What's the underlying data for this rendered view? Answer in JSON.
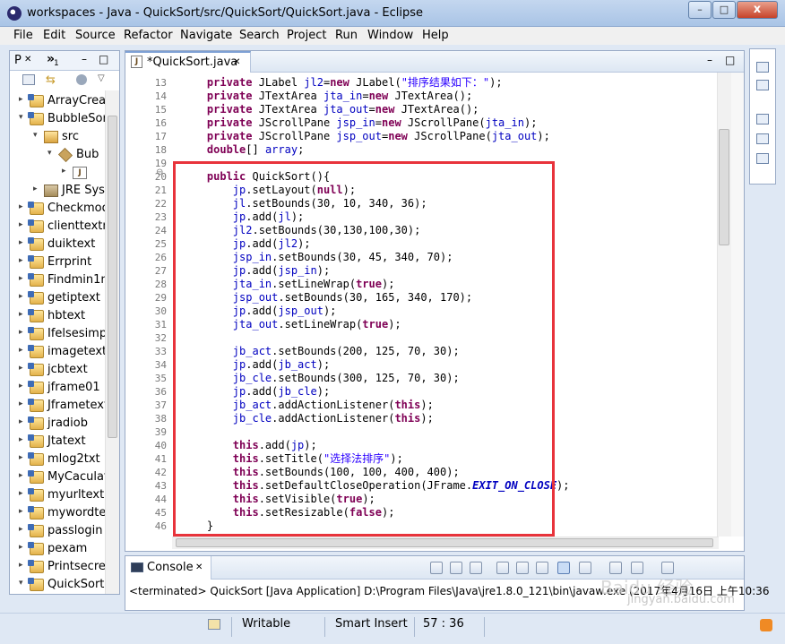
{
  "window": {
    "title": "workspaces - Java - QuickSort/src/QuickSort/QuickSort.java - Eclipse",
    "minimize": "–",
    "maximize": "□",
    "close": "x"
  },
  "menu": [
    "File",
    "Edit",
    "Source",
    "Refactor",
    "Navigate",
    "Search",
    "Project",
    "Run",
    "Window",
    "Help"
  ],
  "package_explorer": {
    "tab_label": "P",
    "tab_close": "✕",
    "second_tab": "»",
    "second_tab_count": "1",
    "minimize": "–",
    "maximize": "□",
    "tree": [
      {
        "label": "ArrayCrea",
        "indent": 1,
        "type": "project",
        "expand": "▸"
      },
      {
        "label": "BubbleSor",
        "indent": 1,
        "type": "project",
        "expand": "▾"
      },
      {
        "label": "src",
        "indent": 2,
        "type": "srcfolder",
        "expand": "▾"
      },
      {
        "label": "Bub",
        "indent": 3,
        "type": "package",
        "expand": "▾"
      },
      {
        "label": "",
        "indent": 4,
        "type": "javafile",
        "expand": "▸"
      },
      {
        "label": "JRE Sys",
        "indent": 2,
        "type": "library",
        "expand": "▸"
      },
      {
        "label": "Checkmod",
        "indent": 1,
        "type": "project",
        "expand": "▸"
      },
      {
        "label": "clienttextn",
        "indent": 1,
        "type": "project",
        "expand": "▸"
      },
      {
        "label": "duiktext",
        "indent": 1,
        "type": "project",
        "expand": "▸"
      },
      {
        "label": "Errprint",
        "indent": 1,
        "type": "project",
        "expand": "▸"
      },
      {
        "label": "Findmin1n",
        "indent": 1,
        "type": "project",
        "expand": "▸"
      },
      {
        "label": "getiptext",
        "indent": 1,
        "type": "project",
        "expand": "▸"
      },
      {
        "label": "hbtext",
        "indent": 1,
        "type": "project",
        "expand": "▸"
      },
      {
        "label": "Ifelsesimp",
        "indent": 1,
        "type": "project",
        "expand": "▸"
      },
      {
        "label": "imagetext",
        "indent": 1,
        "type": "project",
        "expand": "▸"
      },
      {
        "label": "jcbtext",
        "indent": 1,
        "type": "project",
        "expand": "▸"
      },
      {
        "label": "jframe01",
        "indent": 1,
        "type": "project",
        "expand": "▸"
      },
      {
        "label": "Jframetext",
        "indent": 1,
        "type": "project",
        "expand": "▸"
      },
      {
        "label": "jradiob",
        "indent": 1,
        "type": "project",
        "expand": "▸"
      },
      {
        "label": "Jtatext",
        "indent": 1,
        "type": "project",
        "expand": "▸"
      },
      {
        "label": "mlog2txt",
        "indent": 1,
        "type": "project",
        "expand": "▸"
      },
      {
        "label": "MyCaculat",
        "indent": 1,
        "type": "project",
        "expand": "▸"
      },
      {
        "label": "myurltext",
        "indent": 1,
        "type": "project",
        "expand": "▸"
      },
      {
        "label": "mywordte",
        "indent": 1,
        "type": "project",
        "expand": "▸"
      },
      {
        "label": "passlogin",
        "indent": 1,
        "type": "project",
        "expand": "▸"
      },
      {
        "label": "pexam",
        "indent": 1,
        "type": "project",
        "expand": "▸"
      },
      {
        "label": "Printsecre",
        "indent": 1,
        "type": "project",
        "expand": "▸"
      },
      {
        "label": "QuickSort",
        "indent": 1,
        "type": "project",
        "expand": "▾"
      }
    ]
  },
  "editor": {
    "tab_label": "*QuickSort.java",
    "tab_close": "✕",
    "minimize": "–",
    "maximize": "□",
    "fold_marker": "⊖",
    "lines": [
      {
        "n": "13",
        "t": [
          [
            "    ",
            ""
          ],
          [
            "private",
            "kw"
          ],
          [
            " JLabel ",
            ""
          ],
          [
            "jl2",
            "fld"
          ],
          [
            "=",
            ""
          ],
          [
            "new",
            "kw"
          ],
          [
            " JLabel(",
            ""
          ],
          [
            "\"排序结果如下：\"",
            "str"
          ],
          [
            ");",
            ""
          ]
        ]
      },
      {
        "n": "14",
        "t": [
          [
            "    ",
            ""
          ],
          [
            "private",
            "kw"
          ],
          [
            " JTextArea ",
            ""
          ],
          [
            "jta_in",
            "fld"
          ],
          [
            "=",
            ""
          ],
          [
            "new",
            "kw"
          ],
          [
            " JTextArea();",
            ""
          ]
        ]
      },
      {
        "n": "15",
        "t": [
          [
            "    ",
            ""
          ],
          [
            "private",
            "kw"
          ],
          [
            " JTextArea ",
            ""
          ],
          [
            "jta_out",
            "fld"
          ],
          [
            "=",
            ""
          ],
          [
            "new",
            "kw"
          ],
          [
            " JTextArea();",
            ""
          ]
        ]
      },
      {
        "n": "16",
        "t": [
          [
            "    ",
            ""
          ],
          [
            "private",
            "kw"
          ],
          [
            " JScrollPane ",
            ""
          ],
          [
            "jsp_in",
            "fld"
          ],
          [
            "=",
            ""
          ],
          [
            "new",
            "kw"
          ],
          [
            " JScrollPane(",
            ""
          ],
          [
            "jta_in",
            "fld"
          ],
          [
            ");",
            ""
          ]
        ]
      },
      {
        "n": "17",
        "t": [
          [
            "    ",
            ""
          ],
          [
            "private",
            "kw"
          ],
          [
            " JScrollPane ",
            ""
          ],
          [
            "jsp_out",
            "fld"
          ],
          [
            "=",
            ""
          ],
          [
            "new",
            "kw"
          ],
          [
            " JScrollPane(",
            ""
          ],
          [
            "jta_out",
            "fld"
          ],
          [
            ");",
            ""
          ]
        ]
      },
      {
        "n": "18",
        "t": [
          [
            "    ",
            ""
          ],
          [
            "double",
            "kw"
          ],
          [
            "[] ",
            ""
          ],
          [
            "array",
            "fld"
          ],
          [
            ";",
            ""
          ]
        ]
      },
      {
        "n": "19",
        "t": [
          [
            "",
            ""
          ]
        ]
      },
      {
        "n": "20",
        "t": [
          [
            "    ",
            ""
          ],
          [
            "public",
            "kw"
          ],
          [
            " QuickSort(){",
            ""
          ]
        ]
      },
      {
        "n": "21",
        "t": [
          [
            "        ",
            ""
          ],
          [
            "jp",
            "fld"
          ],
          [
            ".setLayout(",
            ""
          ],
          [
            "null",
            "kw"
          ],
          [
            ");",
            ""
          ]
        ]
      },
      {
        "n": "22",
        "t": [
          [
            "        ",
            ""
          ],
          [
            "jl",
            "fld"
          ],
          [
            ".setBounds(30, 10, 340, 36);",
            ""
          ]
        ]
      },
      {
        "n": "23",
        "t": [
          [
            "        ",
            ""
          ],
          [
            "jp",
            "fld"
          ],
          [
            ".add(",
            ""
          ],
          [
            "jl",
            "fld"
          ],
          [
            ");",
            ""
          ]
        ]
      },
      {
        "n": "24",
        "t": [
          [
            "        ",
            ""
          ],
          [
            "jl2",
            "fld"
          ],
          [
            ".setBounds(30,130,100,30);",
            ""
          ]
        ]
      },
      {
        "n": "25",
        "t": [
          [
            "        ",
            ""
          ],
          [
            "jp",
            "fld"
          ],
          [
            ".add(",
            ""
          ],
          [
            "jl2",
            "fld"
          ],
          [
            ");",
            ""
          ]
        ]
      },
      {
        "n": "26",
        "t": [
          [
            "        ",
            ""
          ],
          [
            "jsp_in",
            "fld"
          ],
          [
            ".setBounds(30, 45, 340, 70);",
            ""
          ]
        ]
      },
      {
        "n": "27",
        "t": [
          [
            "        ",
            ""
          ],
          [
            "jp",
            "fld"
          ],
          [
            ".add(",
            ""
          ],
          [
            "jsp_in",
            "fld"
          ],
          [
            ");",
            ""
          ]
        ]
      },
      {
        "n": "28",
        "t": [
          [
            "        ",
            ""
          ],
          [
            "jta_in",
            "fld"
          ],
          [
            ".setLineWrap(",
            ""
          ],
          [
            "true",
            "kw"
          ],
          [
            ");",
            ""
          ]
        ]
      },
      {
        "n": "29",
        "t": [
          [
            "        ",
            ""
          ],
          [
            "jsp_out",
            "fld"
          ],
          [
            ".setBounds(30, 165, 340, 170);",
            ""
          ]
        ]
      },
      {
        "n": "30",
        "t": [
          [
            "        ",
            ""
          ],
          [
            "jp",
            "fld"
          ],
          [
            ".add(",
            ""
          ],
          [
            "jsp_out",
            "fld"
          ],
          [
            ");",
            ""
          ]
        ]
      },
      {
        "n": "31",
        "t": [
          [
            "        ",
            ""
          ],
          [
            "jta_out",
            "fld"
          ],
          [
            ".setLineWrap(",
            ""
          ],
          [
            "true",
            "kw"
          ],
          [
            ");",
            ""
          ]
        ]
      },
      {
        "n": "32",
        "t": [
          [
            "",
            ""
          ]
        ]
      },
      {
        "n": "33",
        "t": [
          [
            "        ",
            ""
          ],
          [
            "jb_act",
            "fld"
          ],
          [
            ".setBounds(200, 125, 70, 30);",
            ""
          ]
        ]
      },
      {
        "n": "34",
        "t": [
          [
            "        ",
            ""
          ],
          [
            "jp",
            "fld"
          ],
          [
            ".add(",
            ""
          ],
          [
            "jb_act",
            "fld"
          ],
          [
            ");",
            ""
          ]
        ]
      },
      {
        "n": "35",
        "t": [
          [
            "        ",
            ""
          ],
          [
            "jb_cle",
            "fld"
          ],
          [
            ".setBounds(300, 125, 70, 30);",
            ""
          ]
        ]
      },
      {
        "n": "36",
        "t": [
          [
            "        ",
            ""
          ],
          [
            "jp",
            "fld"
          ],
          [
            ".add(",
            ""
          ],
          [
            "jb_cle",
            "fld"
          ],
          [
            ");",
            ""
          ]
        ]
      },
      {
        "n": "37",
        "t": [
          [
            "        ",
            ""
          ],
          [
            "jb_act",
            "fld"
          ],
          [
            ".addActionListener(",
            ""
          ],
          [
            "this",
            "kw"
          ],
          [
            ");",
            ""
          ]
        ]
      },
      {
        "n": "38",
        "t": [
          [
            "        ",
            ""
          ],
          [
            "jb_cle",
            "fld"
          ],
          [
            ".addActionListener(",
            ""
          ],
          [
            "this",
            "kw"
          ],
          [
            ");",
            ""
          ]
        ]
      },
      {
        "n": "39",
        "t": [
          [
            "",
            ""
          ]
        ]
      },
      {
        "n": "40",
        "t": [
          [
            "        ",
            ""
          ],
          [
            "this",
            "kw"
          ],
          [
            ".add(",
            ""
          ],
          [
            "jp",
            "fld"
          ],
          [
            ");",
            ""
          ]
        ]
      },
      {
        "n": "41",
        "t": [
          [
            "        ",
            ""
          ],
          [
            "this",
            "kw"
          ],
          [
            ".setTitle(",
            ""
          ],
          [
            "\"选择法排序\"",
            "str"
          ],
          [
            ");",
            ""
          ]
        ]
      },
      {
        "n": "42",
        "t": [
          [
            "        ",
            ""
          ],
          [
            "this",
            "kw"
          ],
          [
            ".setBounds(100, 100, 400, 400);",
            ""
          ]
        ]
      },
      {
        "n": "43",
        "t": [
          [
            "        ",
            ""
          ],
          [
            "this",
            "kw"
          ],
          [
            ".setDefaultCloseOperation(JFrame.",
            ""
          ],
          [
            "EXIT_ON_CLOSE",
            "sfld"
          ],
          [
            ");",
            ""
          ]
        ]
      },
      {
        "n": "44",
        "t": [
          [
            "        ",
            ""
          ],
          [
            "this",
            "kw"
          ],
          [
            ".setVisible(",
            ""
          ],
          [
            "true",
            "kw"
          ],
          [
            ");",
            ""
          ]
        ]
      },
      {
        "n": "45",
        "t": [
          [
            "        ",
            ""
          ],
          [
            "this",
            "kw"
          ],
          [
            ".setResizable(",
            ""
          ],
          [
            "false",
            "kw"
          ],
          [
            ");",
            ""
          ]
        ]
      },
      {
        "n": "46",
        "t": [
          [
            "    }",
            ""
          ]
        ]
      }
    ]
  },
  "console": {
    "tab_label": "Console",
    "tab_close": "✕",
    "status": "<terminated> QuickSort [Java Application] D:\\Program Files\\Java\\jre1.8.0_121\\bin\\javaw.exe (2017年4月16日 上午10:36"
  },
  "statusbar": {
    "writable": "Writable",
    "insert_mode": "Smart Insert",
    "position": "57 : 36"
  },
  "watermark": {
    "main": "Baidu 经验",
    "sub": "jingyan.baidu.com"
  },
  "colors": {
    "keyword": "#7f0055",
    "field": "#0000c0",
    "string": "#2a00ff",
    "highlight_box": "#e8333b"
  }
}
